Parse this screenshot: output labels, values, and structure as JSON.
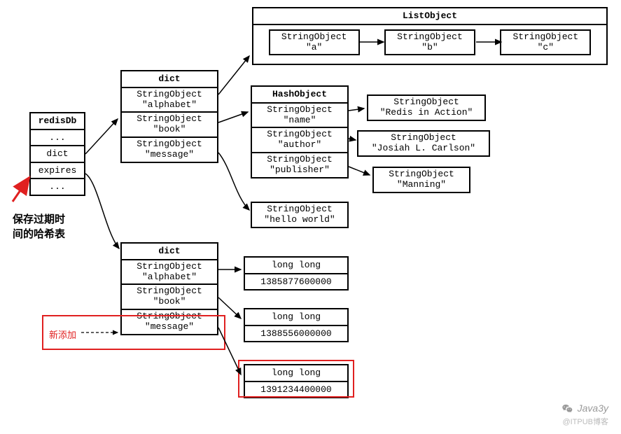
{
  "redisDb": {
    "title": "redisDb",
    "rows": [
      "...",
      "dict",
      "expires",
      "..."
    ]
  },
  "callout_expires": "保存过期时\n间的哈希表",
  "dict_main": {
    "title": "dict",
    "keys": [
      {
        "type": "StringObject",
        "val": "\"alphabet\""
      },
      {
        "type": "StringObject",
        "val": "\"book\""
      },
      {
        "type": "StringObject",
        "val": "\"message\""
      }
    ]
  },
  "list_object": {
    "title": "ListObject",
    "items": [
      {
        "type": "StringObject",
        "val": "\"a\""
      },
      {
        "type": "StringObject",
        "val": "\"b\""
      },
      {
        "type": "StringObject",
        "val": "\"c\""
      }
    ]
  },
  "hash_object": {
    "title": "HashObject",
    "fields": [
      {
        "type": "StringObject",
        "val": "\"name\""
      },
      {
        "type": "StringObject",
        "val": "\"author\""
      },
      {
        "type": "StringObject",
        "val": "\"publisher\""
      }
    ],
    "values": [
      {
        "type": "StringObject",
        "val": "\"Redis in Action\""
      },
      {
        "type": "StringObject",
        "val": "\"Josiah L. Carlson\""
      },
      {
        "type": "StringObject",
        "val": "\"Manning\""
      }
    ]
  },
  "hello": {
    "type": "StringObject",
    "val": "\"hello world\""
  },
  "dict_exp": {
    "title": "dict",
    "keys": [
      {
        "type": "StringObject",
        "val": "\"alphabet\""
      },
      {
        "type": "StringObject",
        "val": "\"book\""
      },
      {
        "type": "StringObject",
        "val": "\"message\""
      }
    ]
  },
  "longs": [
    {
      "type": "long long",
      "val": "1385877600000"
    },
    {
      "type": "long long",
      "val": "1388556000000"
    },
    {
      "type": "long long",
      "val": "1391234400000"
    }
  ],
  "new_label": "新添加",
  "watermark1": "Java3y",
  "watermark2": "@ITPUB博客",
  "chart_data": {
    "type": "diagram",
    "description": "Redis internal data-structure diagram: a redisDb struct with a main key dict and an expires dict. The main dict maps three StringObject keys (alphabet, book, message) to a ListObject [a,b,c], a HashObject {name→Redis in Action, author→Josiah L. Carlson, publisher→Manning}, and the string \"hello world\". The expires dict maps the same three keys to long long timestamps 1385877600000, 1388556000000, 1391234400000. Callout text: '保存过期时间的哈希表' (the hash table that stores expiry times). Red highlight '新添加' (newly added) on the message key and its expiry value."
  }
}
